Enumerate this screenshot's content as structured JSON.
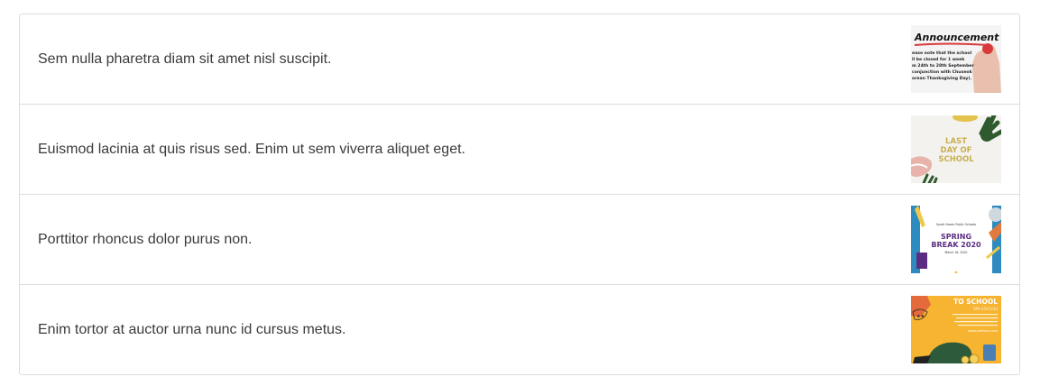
{
  "items": [
    {
      "text": "Sem nulla pharetra diam sit amet nisl suscipit.",
      "thumb": {
        "title": "Announcement",
        "lines": [
          "ease note that the school",
          "ll be closed for 1 week",
          "m 24th to 28th September",
          "conjunction with Chuseok",
          "orean Thanksgiving Day)."
        ]
      }
    },
    {
      "text": "Euismod lacinia at quis risus sed. Enim ut sem viverra aliquet eget.",
      "thumb": {
        "lines": [
          "LAST",
          "DAY OF",
          "SCHOOL"
        ]
      }
    },
    {
      "text": "Porttitor rhoncus dolor purus non.",
      "thumb": {
        "top": "South Haven Public Schools",
        "lines": [
          "SPRING",
          "BREAK 2020"
        ],
        "date": "March 16, 2020"
      }
    },
    {
      "text": "Enim tortor at auctor urna nunc id cursus metus.",
      "thumb": {
        "title": "TO SCHOOL",
        "sub": "SPH 4567234",
        "footer": "www.sitehere.com"
      }
    }
  ],
  "colors": {
    "border": "#dcdcdc",
    "text": "#3b3b3b"
  }
}
